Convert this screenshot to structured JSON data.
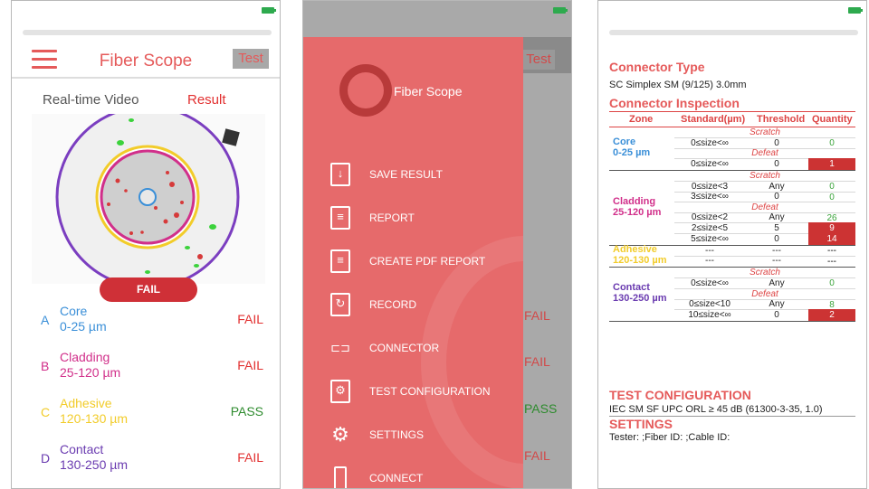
{
  "colors": {
    "accent": "#e55a5a",
    "fail": "#e23030",
    "pass": "#2e8b2e",
    "core": "#3a8fd8",
    "cladding": "#d12f8a",
    "adhesive": "#f2cc2a",
    "contact": "#6a3bb0"
  },
  "panel1": {
    "title": "Fiber Scope",
    "test_label": "Test",
    "tabs": {
      "realtime": "Real-time Video",
      "result": "Result"
    },
    "fail_badge": "FAIL",
    "zones": [
      {
        "letter": "A",
        "name": "Core",
        "range": "0-25 µm",
        "status": "FAIL"
      },
      {
        "letter": "B",
        "name": "Cladding",
        "range": "25-120 µm",
        "status": "FAIL"
      },
      {
        "letter": "C",
        "name": "Adhesive",
        "range": "120-130 µm",
        "status": "PASS"
      },
      {
        "letter": "D",
        "name": "Contact",
        "range": "130-250 µm",
        "status": "FAIL"
      }
    ]
  },
  "panel2": {
    "app_name": "Fiber Scope",
    "test_label": "Test",
    "menu": [
      {
        "label": "SAVE RESULT",
        "icon": "save-icon"
      },
      {
        "label": "REPORT",
        "icon": "report-icon"
      },
      {
        "label": "CREATE PDF REPORT",
        "icon": "pdf-icon"
      },
      {
        "label": "RECORD",
        "icon": "record-icon"
      },
      {
        "label": "CONNECTOR",
        "icon": "connector-icon"
      },
      {
        "label": "TEST CONFIGURATION",
        "icon": "test-config-icon"
      },
      {
        "label": "SETTINGS",
        "icon": "gear-icon"
      },
      {
        "label": "CONNECT",
        "icon": "phone-icon"
      }
    ],
    "behind_statuses": [
      "FAIL",
      "FAIL",
      "PASS",
      "FAIL"
    ]
  },
  "panel3": {
    "connector_type_heading": "Connector Type",
    "connector_type_value": "SC Simplex SM (9/125) 3.0mm",
    "inspection_heading": "Connector Inspection",
    "columns": [
      "Zone",
      "Standard(µm)",
      "Threshold",
      "Quantity"
    ],
    "zones": [
      {
        "name": "Core",
        "range": "0-25 µm",
        "color": "#3a8fd8",
        "rows": [
          {
            "sub": "Scratch"
          },
          {
            "std": "0≤size<∞",
            "thr": "0",
            "qty": "0",
            "state": "green"
          },
          {
            "sub": "Defeat"
          },
          {
            "std": "0≤size<∞",
            "thr": "0",
            "qty": "1",
            "state": "red"
          }
        ]
      },
      {
        "name": "Cladding",
        "range": "25-120 µm",
        "color": "#d12f8a",
        "rows": [
          {
            "sub": "Scratch"
          },
          {
            "std": "0≤size<3",
            "thr": "Any",
            "qty": "0",
            "state": "green"
          },
          {
            "std": "3≤size<∞",
            "thr": "0",
            "qty": "0",
            "state": "green"
          },
          {
            "sub": "Defeat"
          },
          {
            "std": "0≤size<2",
            "thr": "Any",
            "qty": "26",
            "state": "green"
          },
          {
            "std": "2≤size<5",
            "thr": "5",
            "qty": "9",
            "state": "red"
          },
          {
            "std": "5≤size<∞",
            "thr": "0",
            "qty": "14",
            "state": "red"
          }
        ]
      },
      {
        "name": "Adhesive",
        "range": "120-130 µm",
        "color": "#f2cc2a",
        "rows": [
          {
            "std": "---",
            "thr": "---",
            "qty": "---",
            "state": "plain"
          },
          {
            "std": "---",
            "thr": "---",
            "qty": "---",
            "state": "plain"
          }
        ]
      },
      {
        "name": "Contact",
        "range": "130-250 µm",
        "color": "#6a3bb0",
        "rows": [
          {
            "sub": "Scratch"
          },
          {
            "std": "0≤size<∞",
            "thr": "Any",
            "qty": "0",
            "state": "green"
          },
          {
            "sub": "Defeat"
          },
          {
            "std": "0≤size<10",
            "thr": "Any",
            "qty": "8",
            "state": "green"
          },
          {
            "std": "10≤size<∞",
            "thr": "0",
            "qty": "2",
            "state": "red"
          }
        ]
      }
    ],
    "test_config_heading": "TEST CONFIGURATION",
    "test_config_value": "IEC SM SF UPC ORL ≥ 45 dB (61300-3-35, 1.0)",
    "settings_heading": "SETTINGS",
    "settings_value": "Tester: ;Fiber ID: ;Cable ID:"
  }
}
